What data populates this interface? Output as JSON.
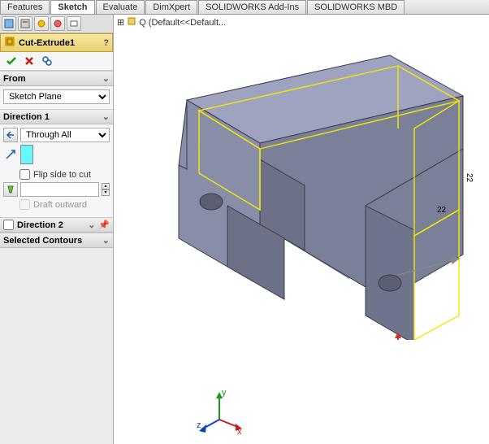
{
  "tabs": {
    "features": "Features",
    "sketch": "Sketch",
    "evaluate": "Evaluate",
    "dimxpert": "DimXpert",
    "addins": "SOLIDWORKS Add-Ins",
    "mbd": "SOLIDWORKS MBD"
  },
  "feature": {
    "name": "Cut-Extrude1",
    "help": "?"
  },
  "tree": {
    "prefix": "Q",
    "node": "(Default<<Default..."
  },
  "from": {
    "label": "From",
    "plane": "Sketch Plane"
  },
  "direction1": {
    "label": "Direction 1",
    "condition": "Through All",
    "flip_label": "Flip side to cut",
    "flip_checked": false,
    "draft_value": "",
    "draft_outward_label": "Draft outward",
    "draft_outward_checked": false
  },
  "direction2": {
    "label": "Direction 2",
    "checked": false
  },
  "selected_contours": {
    "label": "Selected Contours"
  },
  "dimensions": {
    "width": "22",
    "height": "22"
  },
  "chevrons": {
    "down": "⌄",
    "up": "˄"
  },
  "triad": {
    "x": "x",
    "y": "y",
    "z": "z"
  }
}
